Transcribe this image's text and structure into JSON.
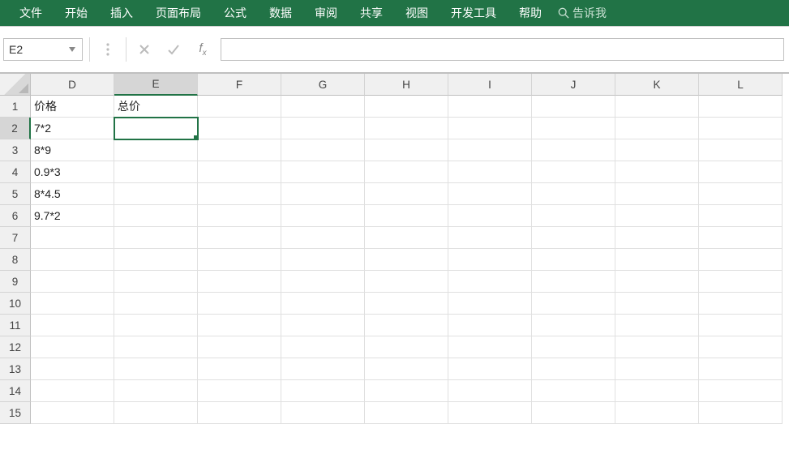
{
  "ribbon": {
    "items": [
      "文件",
      "开始",
      "插入",
      "页面布局",
      "公式",
      "数据",
      "审阅",
      "共享",
      "视图",
      "开发工具",
      "帮助"
    ],
    "tell_me": "告诉我"
  },
  "formula_bar": {
    "name_box": "E2",
    "formula_value": ""
  },
  "grid": {
    "columns": [
      "D",
      "E",
      "F",
      "G",
      "H",
      "I",
      "J",
      "K",
      "L"
    ],
    "row_count": 15,
    "active_cell": {
      "row": 2,
      "col": "E"
    },
    "cells": {
      "D1": "价格",
      "E1": "总价",
      "D2": "7*2",
      "D3": "8*9",
      "D4": "0.9*3",
      "D5": "8*4.5",
      "D6": "9.7*2"
    }
  }
}
